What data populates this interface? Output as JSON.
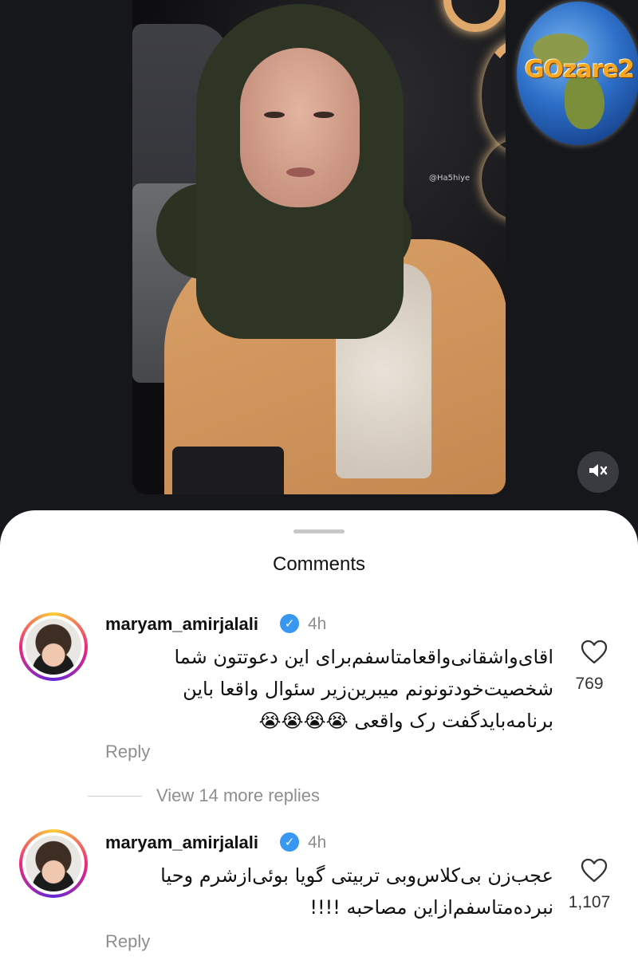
{
  "video": {
    "watermark": "@Ha5hiye",
    "mute_icon": "speaker-muted-icon"
  },
  "logo": {
    "text": "GOzare2"
  },
  "sheet": {
    "title": "Comments"
  },
  "comments": [
    {
      "username": "maryam_amirjalali",
      "verified": true,
      "time": "4h",
      "text": "اقای‌واشقانی‌واقعامتاسفم‌برای این دعوتتون شما شخصیت‌خودتونونم میبرین‌زیر سئوال واقعا باین برنامه‌بایدگفت رک واقعی 😭😭😭😭",
      "likes": "769",
      "reply_label": "Reply"
    },
    {
      "username": "maryam_amirjalali",
      "verified": true,
      "time": "4h",
      "text": "عجب‌زن بی‌کلاس‌وبی تربیتی گویا بوئی‌ازشرم وحیا نبرده‌متاسفم‌ازاین مصاحبه !!!!",
      "likes": "1,107",
      "reply_label": "Reply"
    }
  ],
  "view_replies": {
    "label": "View 14 more replies"
  },
  "colors": {
    "verified_blue": "#3897f0",
    "muted_text": "#8e8e8e",
    "background_dark": "#17181b"
  }
}
